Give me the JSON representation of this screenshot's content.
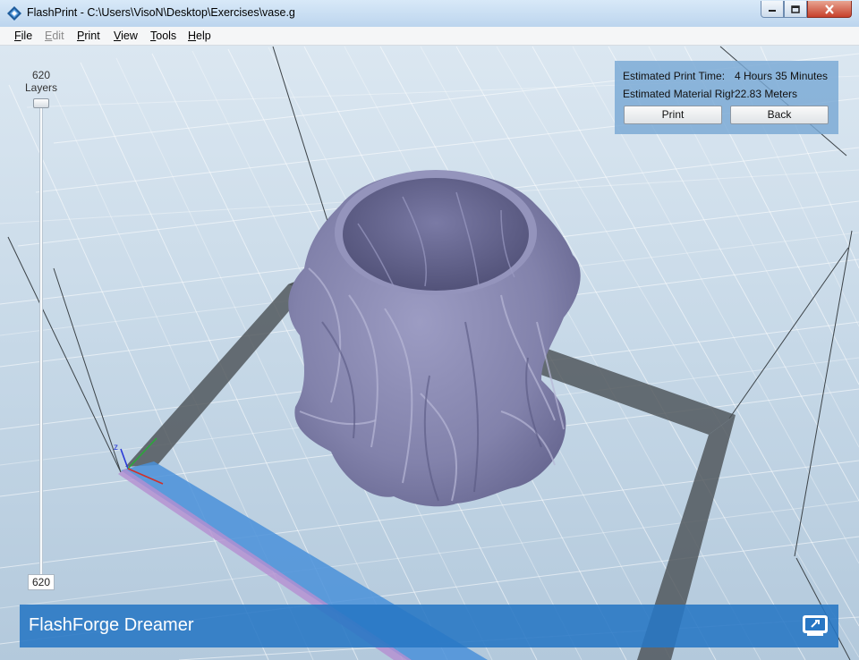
{
  "window": {
    "title": "FlashPrint - C:\\Users\\VisoN\\Desktop\\Exercises\\vase.g",
    "app_icon": "flashprint-logo-icon",
    "controls": [
      "minimize-icon",
      "maximize-icon",
      "close-icon"
    ]
  },
  "menu": {
    "file": "File",
    "edit": "Edit",
    "print": "Print",
    "view": "View",
    "tools": "Tools",
    "help": "Help"
  },
  "layers": {
    "count_top": "620",
    "label": "Layers",
    "current_value": "620"
  },
  "info_panel": {
    "time_label": "Estimated Print Time:",
    "time_value": "4 Hours 35 Minutes",
    "material_label": "Estimated Material Right",
    "material_value": "22.83 Meters",
    "print_button": "Print",
    "back_button": "Back"
  },
  "axes": {
    "z_label": "z"
  },
  "banner": {
    "printer_name": "FlashForge Dreamer",
    "icon": "machine-settings-icon"
  },
  "colors": {
    "model": "#8585ad",
    "panel": "#79a8d4",
    "banner": "#2776c4",
    "close_button": "#c7402b"
  }
}
